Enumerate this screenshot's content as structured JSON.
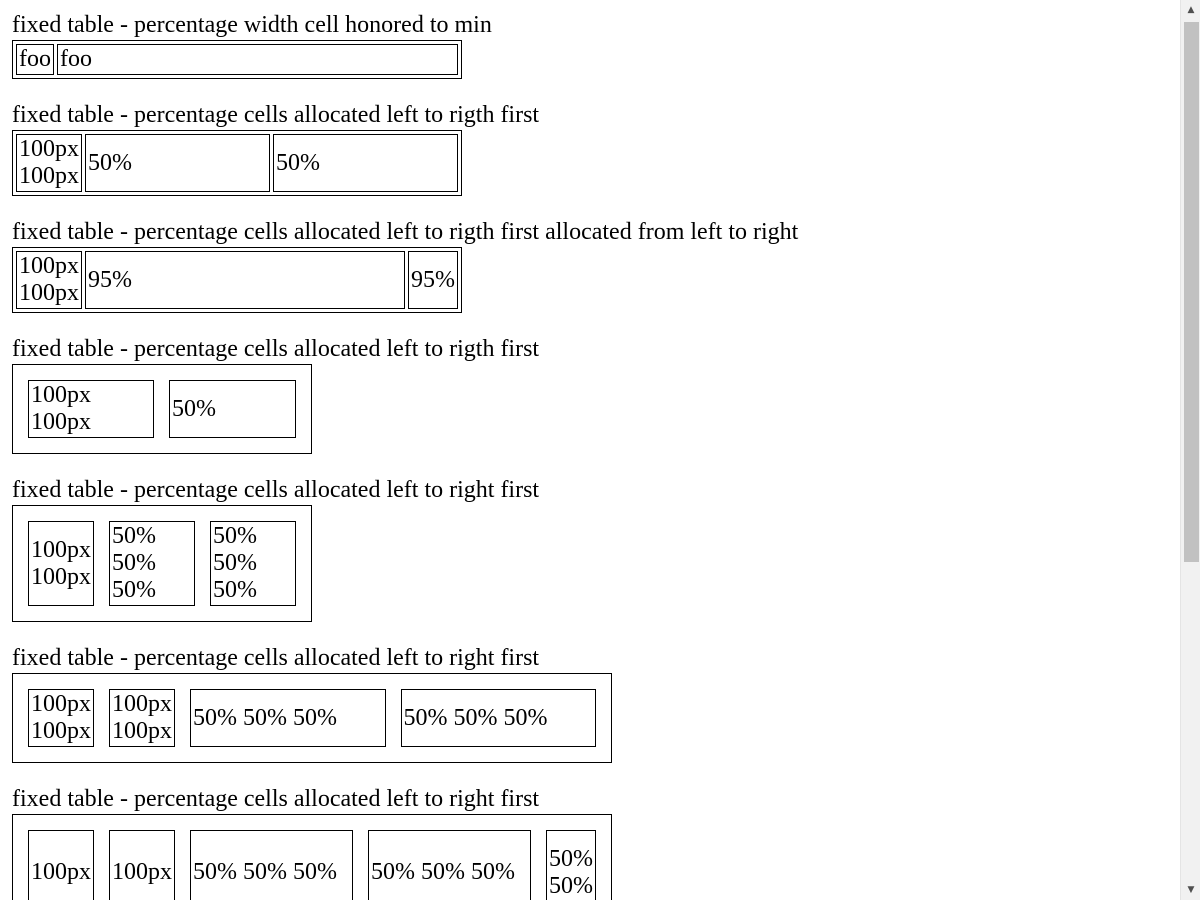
{
  "sections": [
    {
      "title": "fixed table - percentage width cell honored to min",
      "cells": [
        "foo",
        "foo"
      ]
    },
    {
      "title": "fixed table - percentage cells allocated left to rigth first",
      "cells": [
        "100px 100px",
        "50%",
        "50%"
      ]
    },
    {
      "title": "fixed table - percentage cells allocated left to rigth first allocated from left to right",
      "cells": [
        "100px 100px",
        "95%",
        "95%"
      ]
    },
    {
      "title": "fixed table - percentage cells allocated left to rigth first",
      "cells": [
        "100px 100px",
        "50%"
      ]
    },
    {
      "title": "fixed table - percentage cells allocated left to right first",
      "cells": [
        "100px 100px",
        "50% 50% 50%",
        "50% 50% 50%"
      ]
    },
    {
      "title": "fixed table - percentage cells allocated left to right first",
      "cells": [
        "100px 100px",
        "100px 100px",
        "50% 50% 50%",
        "50% 50% 50%"
      ]
    },
    {
      "title": "fixed table - percentage cells allocated left to right first",
      "cells": [
        "100px",
        "100px",
        "50% 50% 50%",
        "50% 50% 50%",
        "50% 50%"
      ]
    }
  ],
  "scrollbar": {
    "up_arrow": "▲",
    "down_arrow": "▼"
  }
}
